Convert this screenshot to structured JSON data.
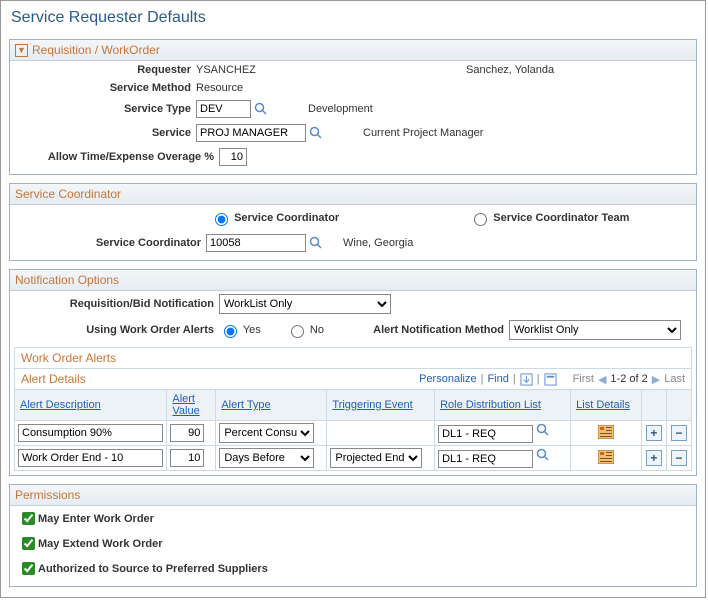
{
  "page": {
    "title": "Service Requester Defaults"
  },
  "requisition": {
    "header": "Requisition / WorkOrder",
    "requester_label": "Requester",
    "requester_id": "YSANCHEZ",
    "requester_name": "Sanchez, Yolanda",
    "service_method_label": "Service Method",
    "service_method_value": "Resource",
    "service_type_label": "Service Type",
    "service_type_value": "DEV",
    "service_type_desc": "Development",
    "service_label": "Service",
    "service_value": "PROJ MANAGER",
    "service_desc": "Current Project Manager",
    "overage_label": "Allow Time/Expense Overage %",
    "overage_value": "10"
  },
  "coordinator": {
    "header": "Service Coordinator",
    "radio1": "Service Coordinator",
    "radio2": "Service Coordinator Team",
    "coord_label": "Service Coordinator",
    "coord_value": "10058",
    "coord_name": "Wine, Georgia"
  },
  "notifications": {
    "header": "Notification Options",
    "req_bid_label": "Requisition/Bid Notification",
    "req_bid_value": "WorkList Only",
    "using_wo_alerts_label": "Using Work Order Alerts",
    "yes": "Yes",
    "no": "No",
    "alert_method_label": "Alert Notification Method",
    "alert_method_value": "Worklist Only",
    "wo_alerts_header": "Work Order Alerts",
    "alert_details_label": "Alert Details",
    "personalize": "Personalize",
    "find": "Find",
    "first": "First",
    "range": "1-2 of 2",
    "last": "Last",
    "columns": {
      "alert_desc": "Alert Description",
      "alert_value": "Alert Value",
      "alert_type": "Alert Type",
      "triggering_event": "Triggering Event",
      "role_dist": "Role Distribution List",
      "list_details": "List Details"
    },
    "rows": [
      {
        "desc": "Consumption 90%",
        "value": "90",
        "type": "Percent Consumed",
        "event": "",
        "role": "DL1 - REQ"
      },
      {
        "desc": "Work Order End - 10",
        "value": "10",
        "type": "Days Before",
        "event": "Projected End",
        "role": "DL1 - REQ"
      }
    ]
  },
  "permissions": {
    "header": "Permissions",
    "may_enter": "May Enter Work Order",
    "may_extend": "May Extend Work Order",
    "authorized": "Authorized to Source to Preferred Suppliers"
  }
}
